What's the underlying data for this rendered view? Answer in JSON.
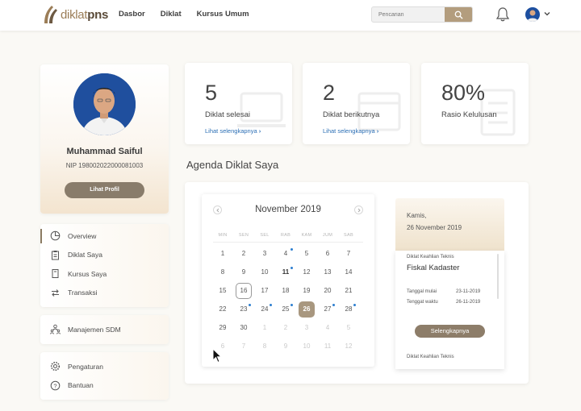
{
  "header": {
    "logo_prefix": "diklat",
    "logo_suffix": "pns",
    "nav": [
      "Dasbor",
      "Diklat",
      "Kursus Umum"
    ],
    "search_placeholder": "Pencarian"
  },
  "profile": {
    "name": "Muhammad Saiful",
    "nip": "NIP 198002022000081003",
    "button": "Lihat Profil"
  },
  "menu_main": [
    {
      "label": "Overview",
      "icon": "pie-chart-icon"
    },
    {
      "label": "Diklat Saya",
      "icon": "clipboard-icon"
    },
    {
      "label": "Kursus Saya",
      "icon": "book-icon"
    },
    {
      "label": "Transaksi",
      "icon": "swap-arrows-icon"
    }
  ],
  "menu_admin": [
    {
      "label": "Manajemen SDM",
      "icon": "people-icon"
    }
  ],
  "menu_settings": [
    {
      "label": "Pengaturan",
      "icon": "gear-icon"
    },
    {
      "label": "Bantuan",
      "icon": "help-icon"
    }
  ],
  "stats": [
    {
      "value": "5",
      "label": "Diklat selesai",
      "link": "Lihat selengkapnya"
    },
    {
      "value": "2",
      "label": "Diklat berikutnya",
      "link": "Lihat selengkapnya"
    },
    {
      "value": "80%",
      "label": "Rasio Kelulusan",
      "link": ""
    }
  ],
  "agenda": {
    "title": "Agenda Diklat Saya",
    "month": "November 2019",
    "weekdays": [
      "MIN",
      "SEN",
      "SEL",
      "RAB",
      "KAM",
      "JUM",
      "SAB"
    ],
    "weeks": [
      [
        {
          "d": "1",
          "m": 0
        },
        {
          "d": "2",
          "m": 0
        },
        {
          "d": "3",
          "m": 0
        },
        {
          "d": "4",
          "m": 0,
          "dot": 1
        },
        {
          "d": "5",
          "m": 0
        },
        {
          "d": "6",
          "m": 0
        },
        {
          "d": "7",
          "m": 0
        }
      ],
      [
        {
          "d": "8",
          "m": 0
        },
        {
          "d": "9",
          "m": 0
        },
        {
          "d": "10",
          "m": 0
        },
        {
          "d": "11",
          "m": 0,
          "dot": 1,
          "b": 1
        },
        {
          "d": "12",
          "m": 0
        },
        {
          "d": "13",
          "m": 0
        },
        {
          "d": "14",
          "m": 0
        }
      ],
      [
        {
          "d": "15",
          "m": 0
        },
        {
          "d": "16",
          "m": 0,
          "today": 1
        },
        {
          "d": "17",
          "m": 0
        },
        {
          "d": "18",
          "m": 0
        },
        {
          "d": "19",
          "m": 0
        },
        {
          "d": "20",
          "m": 0
        },
        {
          "d": "21",
          "m": 0
        }
      ],
      [
        {
          "d": "22",
          "m": 0
        },
        {
          "d": "23",
          "m": 0,
          "dot": 1
        },
        {
          "d": "24",
          "m": 0,
          "dot": 1
        },
        {
          "d": "25",
          "m": 0,
          "dot": 1
        },
        {
          "d": "26",
          "m": 0,
          "sel": 1
        },
        {
          "d": "27",
          "m": 0,
          "dot": 1
        },
        {
          "d": "28",
          "m": 0,
          "dot": 1
        }
      ],
      [
        {
          "d": "29",
          "m": 0
        },
        {
          "d": "30",
          "m": 0
        },
        {
          "d": "1",
          "m": 1
        },
        {
          "d": "2",
          "m": 1
        },
        {
          "d": "3",
          "m": 1
        },
        {
          "d": "4",
          "m": 1
        },
        {
          "d": "5",
          "m": 1
        }
      ],
      [
        {
          "d": "6",
          "m": 1
        },
        {
          "d": "7",
          "m": 1
        },
        {
          "d": "8",
          "m": 1
        },
        {
          "d": "9",
          "m": 1
        },
        {
          "d": "10",
          "m": 1
        },
        {
          "d": "11",
          "m": 1
        },
        {
          "d": "12",
          "m": 1
        }
      ]
    ]
  },
  "event": {
    "day": "Kamis,",
    "date": "26 November 2019",
    "category": "Diklat Keahlian Teknis",
    "title": "Fiskal Kadaster",
    "start_label": "Tanggal mulai",
    "start_value": "23-11-2019",
    "end_label": "Tenggat waktu",
    "end_value": "26-11-2019",
    "button": "Selengkapnya",
    "next_category": "Diklat Keahlian Teknis"
  },
  "colors": {
    "accent": "#8d7d69",
    "dot": "#2c7fd0",
    "link": "#2c6fb5"
  }
}
